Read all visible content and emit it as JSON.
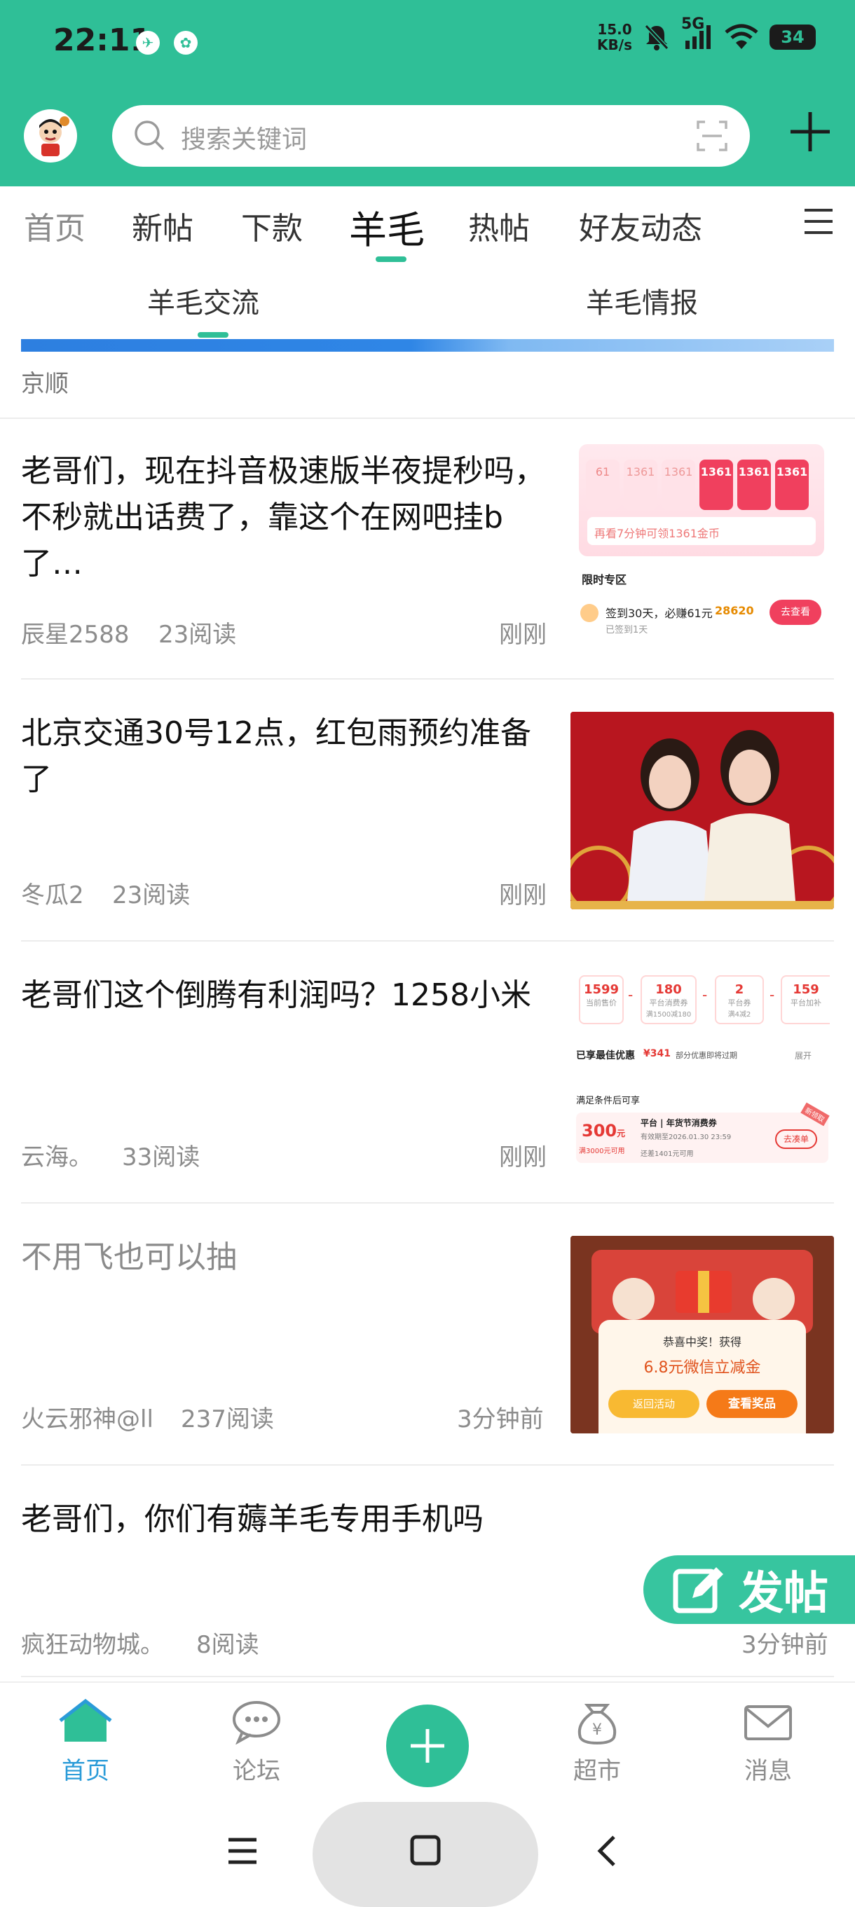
{
  "status_bar": {
    "time": "22:11",
    "net_speed_value": "15.0",
    "net_speed_unit": "KB/s",
    "network": "5G",
    "battery": "34"
  },
  "search": {
    "placeholder": "搜索关键词"
  },
  "tabs": [
    {
      "label": "首页"
    },
    {
      "label": "新帖"
    },
    {
      "label": "下款"
    },
    {
      "label": "羊毛"
    },
    {
      "label": "热帖"
    },
    {
      "label": "好友动态"
    }
  ],
  "subtabs": [
    {
      "label": "羊毛交流"
    },
    {
      "label": "羊毛情报"
    }
  ],
  "partial_author": "京顺",
  "posts": [
    {
      "title": "老哥们，现在抖音极速版半夜提秒吗，不秒就出话费了，靠这个在网吧挂b了…",
      "author": "辰星2588",
      "reads": "23阅读",
      "time": "刚刚",
      "thumb": {
        "nums": [
          "61",
          "1361",
          "1361",
          "1361",
          "1361",
          "1361"
        ],
        "line1": "再看7分钟可领1361金币",
        "section": "限时专区",
        "sign": "签到30天，必赚61元",
        "coins": "28620",
        "btn": "去查看",
        "sub": "已签到1天"
      }
    },
    {
      "title": "北京交通30号12点，红包雨预约准备了",
      "author": "冬瓜2",
      "reads": "23阅读",
      "time": "刚刚"
    },
    {
      "title": "老哥们这个倒腾有利润吗？1258小米",
      "author": "云海。",
      "reads": "33阅读",
      "time": "刚刚",
      "thumb": {
        "p1": "1599",
        "p1_label": "当前售价",
        "p2": "180",
        "p2_label": "平台消费券",
        "p2_sub": "满1500减180",
        "p3": "2",
        "p3_label": "平台券",
        "p3_sub": "满4减2",
        "p4": "159",
        "p4_label": "平台加补",
        "best": "已享最佳优惠",
        "best_val": "¥341",
        "best_note": "部分优惠即将过期",
        "expand": "展开",
        "cond": "满足条件后可享",
        "coupon_amt": "300",
        "coupon_unit": "元",
        "coupon_cond": "满3000元可用",
        "coupon_title": "平台 | 年货节消费券",
        "coupon_valid": "有效期至2026.01.30 23:59",
        "coupon_need": "还差1401元可用",
        "coupon_btn": "去凑单",
        "tag": "新领取"
      }
    },
    {
      "title": "不用飞也可以抽",
      "author": "火云邪神@ll",
      "reads": "237阅读",
      "time": "3分钟前",
      "thumb": {
        "congrats": "恭喜中奖！获得",
        "prize": "6.8元微信立减金",
        "btn_back": "返回活动",
        "btn_view": "查看奖品"
      }
    },
    {
      "title": "老哥们，你们有薅羊毛专用手机吗",
      "author": "疯狂动物城。",
      "reads": "8阅读",
      "time": "3分钟前"
    }
  ],
  "float_post": "发帖",
  "bottom_nav": [
    {
      "label": "首页"
    },
    {
      "label": "论坛"
    },
    {
      "label": "超市"
    },
    {
      "label": "消息"
    }
  ],
  "colors": {
    "brand": "#2fbf97",
    "active_nav": "#2a9bd8"
  }
}
